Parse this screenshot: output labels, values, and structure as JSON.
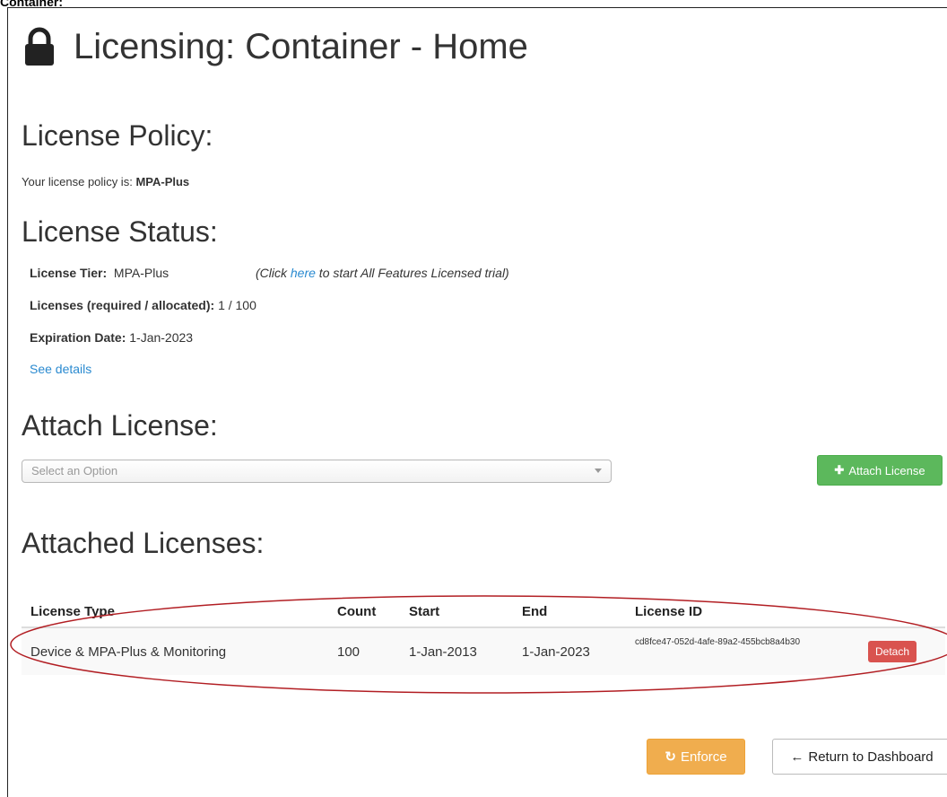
{
  "caption": "Container:",
  "page": {
    "title": "Licensing: Container - Home",
    "lock_icon": "lock-icon"
  },
  "policy": {
    "heading": "License Policy:",
    "label": "Your license policy is:",
    "value": "MPA-Plus"
  },
  "status": {
    "heading": "License Status:",
    "tier_label": "License Tier:",
    "tier_value": "MPA-Plus",
    "trial_prefix": "(Click ",
    "trial_link": "here",
    "trial_suffix": " to start All Features Licensed trial)",
    "licenses_label": "Licenses (required / allocated):",
    "licenses_value": "1 / 100",
    "expiration_label": "Expiration Date:",
    "expiration_value": "1-Jan-2023",
    "details_link": "See details"
  },
  "attach": {
    "heading": "Attach License:",
    "select_placeholder": "Select an Option",
    "button_label": "Attach License"
  },
  "attached": {
    "heading": "Attached Licenses:",
    "columns": [
      "License Type",
      "Count",
      "Start",
      "End",
      "License ID"
    ],
    "rows": [
      {
        "type": "Device & MPA-Plus & Monitoring",
        "count": "100",
        "start": "1-Jan-2013",
        "end": "1-Jan-2023",
        "id": "cd8fce47-052d-4afe-89a2-455bcb8a4b30",
        "action": "Detach"
      }
    ]
  },
  "footer": {
    "enforce_label": "Enforce",
    "return_label": "Return to Dashboard"
  },
  "colors": {
    "link": "#2a8ad0",
    "success": "#5cb85c",
    "warning": "#f0ad4e",
    "danger": "#d9534f",
    "annotation": "#b21e23"
  }
}
